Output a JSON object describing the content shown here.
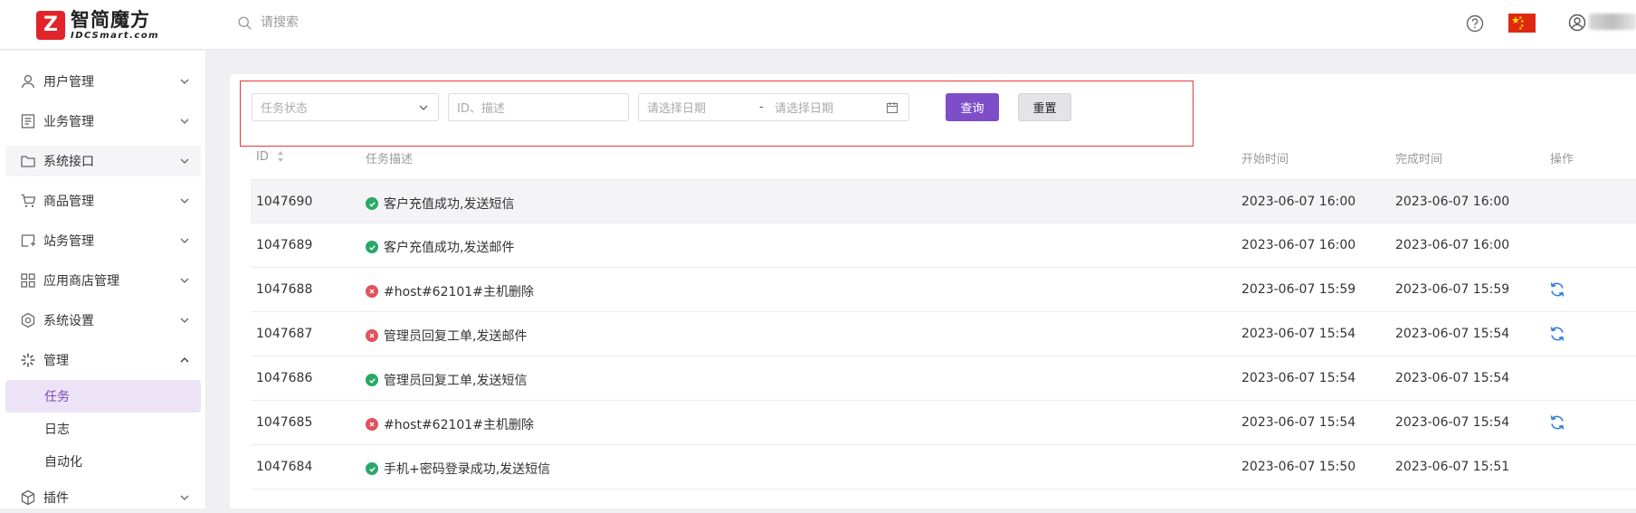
{
  "brand": {
    "logo_mark": "Z",
    "name_cn": "智简魔方",
    "name_en": "IDCSmart.com"
  },
  "header": {
    "search_placeholder": "请搜索",
    "icons": [
      "search-icon",
      "help-icon",
      "china-flag-icon",
      "user-icon"
    ]
  },
  "sidebar": {
    "items": [
      {
        "label": "用户管理",
        "icon": "user-icon",
        "expanded": false
      },
      {
        "label": "业务管理",
        "icon": "document-icon",
        "expanded": false
      },
      {
        "label": "系统接口",
        "icon": "folder-icon",
        "expanded": false
      },
      {
        "label": "商品管理",
        "icon": "cart-icon",
        "expanded": false
      },
      {
        "label": "站务管理",
        "icon": "station-icon",
        "expanded": false
      },
      {
        "label": "应用商店管理",
        "icon": "apps-icon",
        "expanded": false
      },
      {
        "label": "系统设置",
        "icon": "settings-icon",
        "expanded": false
      },
      {
        "label": "管理",
        "icon": "manage-icon",
        "expanded": true
      },
      {
        "label": "插件",
        "icon": "plugin-icon",
        "expanded": false
      }
    ],
    "sub_items": [
      {
        "label": "任务",
        "active": true
      },
      {
        "label": "日志",
        "active": false
      },
      {
        "label": "自动化",
        "active": false
      }
    ]
  },
  "filters": {
    "status_placeholder": "任务状态",
    "keyword_placeholder": "ID、描述",
    "date_start_placeholder": "请选择日期",
    "date_separator": "-",
    "date_end_placeholder": "请选择日期",
    "query_label": "查询",
    "reset_label": "重置"
  },
  "table": {
    "columns": [
      "ID",
      "任务描述",
      "开始时间",
      "完成时间",
      "操作"
    ],
    "rows": [
      {
        "id": "1047690",
        "desc": "客户充值成功,发送短信",
        "status": "success",
        "start": "2023-06-07 16:00",
        "end": "2023-06-07 16:00",
        "retry": false
      },
      {
        "id": "1047689",
        "desc": "客户充值成功,发送邮件",
        "status": "success",
        "start": "2023-06-07 16:00",
        "end": "2023-06-07 16:00",
        "retry": false
      },
      {
        "id": "1047688",
        "desc": "#host#62101#主机删除",
        "status": "failed",
        "start": "2023-06-07 15:59",
        "end": "2023-06-07 15:59",
        "retry": true
      },
      {
        "id": "1047687",
        "desc": "管理员回复工单,发送邮件",
        "status": "failed",
        "start": "2023-06-07 15:54",
        "end": "2023-06-07 15:54",
        "retry": true
      },
      {
        "id": "1047686",
        "desc": "管理员回复工单,发送短信",
        "status": "success",
        "start": "2023-06-07 15:54",
        "end": "2023-06-07 15:54",
        "retry": false
      },
      {
        "id": "1047685",
        "desc": "#host#62101#主机删除",
        "status": "failed",
        "start": "2023-06-07 15:54",
        "end": "2023-06-07 15:54",
        "retry": true
      },
      {
        "id": "1047684",
        "desc": "手机+密码登录成功,发送短信",
        "status": "success",
        "start": "2023-06-07 15:50",
        "end": "2023-06-07 15:51",
        "retry": false
      }
    ]
  },
  "colors": {
    "accent": "#7e4ec9",
    "active_bg": "#ece3f6",
    "success": "#2aa86a",
    "failed": "#e0525c",
    "retry": "#2f7ed8",
    "highlight_border": "#e33a3a"
  }
}
